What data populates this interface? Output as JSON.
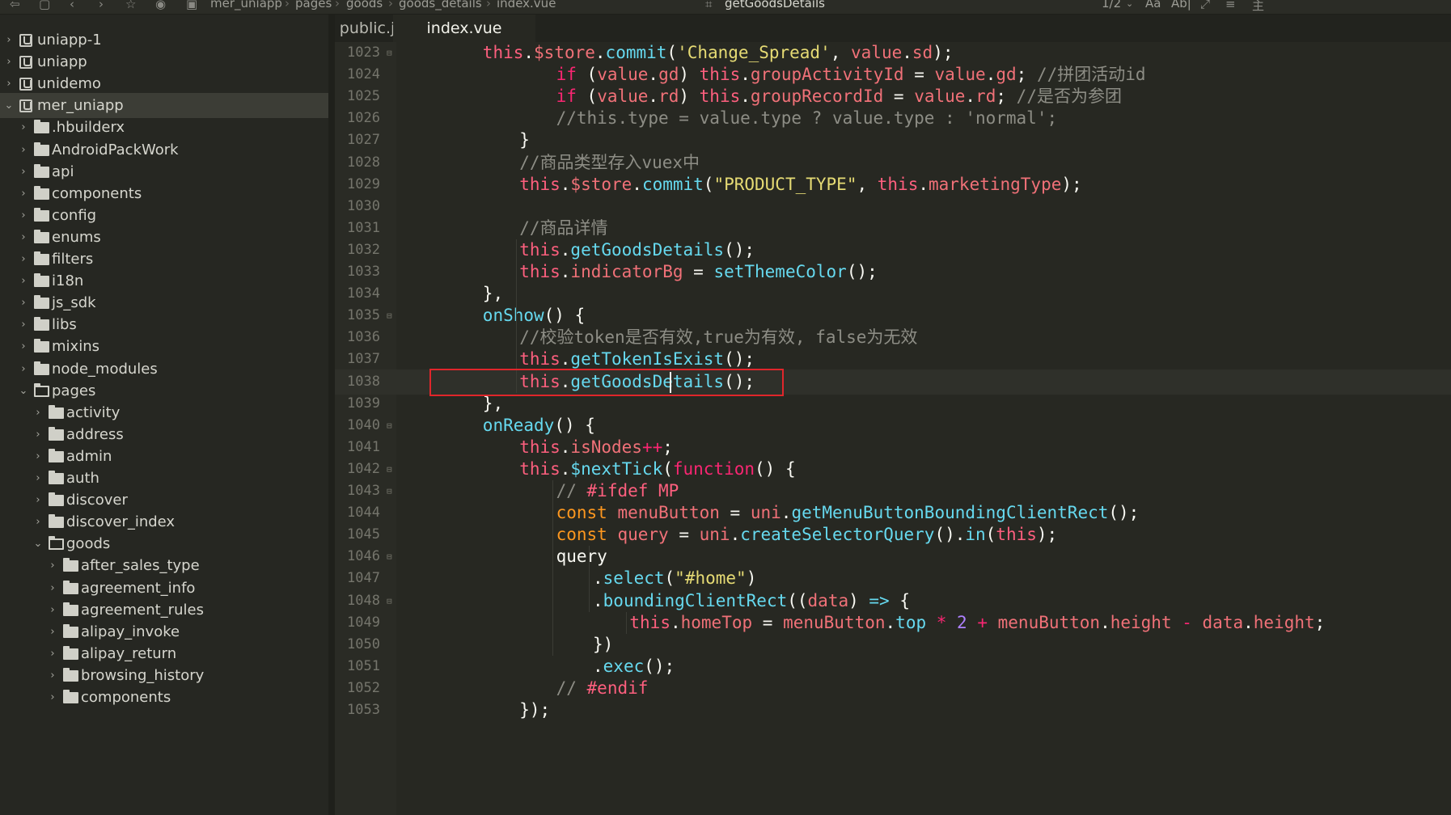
{
  "toolbar": {
    "breadcrumb": [
      "mer_uniapp",
      "pages",
      "goods",
      "goods_details",
      "index.vue"
    ],
    "function_name": "getGoodsDetails",
    "zoom_label": "1/2",
    "font_label": "Aa",
    "word_label": "Ab|",
    "icons": [
      "back-icon",
      "forward-icon",
      "star-icon",
      "run-icon",
      "pin-icon",
      "menu-icon"
    ]
  },
  "sidebar": {
    "items": [
      {
        "label": "uniapp-1",
        "kind": "project",
        "depth": 0,
        "expanded": false
      },
      {
        "label": "uniapp",
        "kind": "project",
        "depth": 0,
        "expanded": false
      },
      {
        "label": "unidemo",
        "kind": "project",
        "depth": 0,
        "expanded": false
      },
      {
        "label": "mer_uniapp",
        "kind": "project",
        "depth": 0,
        "expanded": true,
        "selected": true
      },
      {
        "label": ".hbuilderx",
        "kind": "folder",
        "depth": 1,
        "expanded": false
      },
      {
        "label": "AndroidPackWork",
        "kind": "folder",
        "depth": 1,
        "expanded": false
      },
      {
        "label": "api",
        "kind": "folder",
        "depth": 1,
        "expanded": false
      },
      {
        "label": "components",
        "kind": "folder",
        "depth": 1,
        "expanded": false
      },
      {
        "label": "config",
        "kind": "folder",
        "depth": 1,
        "expanded": false
      },
      {
        "label": "enums",
        "kind": "folder",
        "depth": 1,
        "expanded": false
      },
      {
        "label": "filters",
        "kind": "folder",
        "depth": 1,
        "expanded": false
      },
      {
        "label": "i18n",
        "kind": "folder",
        "depth": 1,
        "expanded": false
      },
      {
        "label": "js_sdk",
        "kind": "folder",
        "depth": 1,
        "expanded": false
      },
      {
        "label": "libs",
        "kind": "folder",
        "depth": 1,
        "expanded": false
      },
      {
        "label": "mixins",
        "kind": "folder",
        "depth": 1,
        "expanded": false
      },
      {
        "label": "node_modules",
        "kind": "folder",
        "depth": 1,
        "expanded": false
      },
      {
        "label": "pages",
        "kind": "folder",
        "depth": 1,
        "expanded": true
      },
      {
        "label": "activity",
        "kind": "folder",
        "depth": 2,
        "expanded": false
      },
      {
        "label": "address",
        "kind": "folder",
        "depth": 2,
        "expanded": false
      },
      {
        "label": "admin",
        "kind": "folder",
        "depth": 2,
        "expanded": false
      },
      {
        "label": "auth",
        "kind": "folder",
        "depth": 2,
        "expanded": false
      },
      {
        "label": "discover",
        "kind": "folder",
        "depth": 2,
        "expanded": false
      },
      {
        "label": "discover_index",
        "kind": "folder",
        "depth": 2,
        "expanded": false
      },
      {
        "label": "goods",
        "kind": "folder",
        "depth": 2,
        "expanded": true
      },
      {
        "label": "after_sales_type",
        "kind": "folder",
        "depth": 3,
        "expanded": false
      },
      {
        "label": "agreement_info",
        "kind": "folder",
        "depth": 3,
        "expanded": false
      },
      {
        "label": "agreement_rules",
        "kind": "folder",
        "depth": 3,
        "expanded": false
      },
      {
        "label": "alipay_invoke",
        "kind": "folder",
        "depth": 3,
        "expanded": false
      },
      {
        "label": "alipay_return",
        "kind": "folder",
        "depth": 3,
        "expanded": false
      },
      {
        "label": "browsing_history",
        "kind": "folder",
        "depth": 3,
        "expanded": false
      },
      {
        "label": "components",
        "kind": "folder",
        "depth": 3,
        "expanded": false
      }
    ]
  },
  "tabs": [
    {
      "label": "public.js",
      "active": false
    },
    {
      "label": "index.vue",
      "active": true
    }
  ],
  "editor": {
    "current_line": 1038,
    "lines": [
      {
        "n": "1023",
        "fold": true,
        "indent": 2,
        "tokens": [
          [
            "this",
            "t"
          ],
          [
            ".",
            "pl"
          ],
          [
            "$store",
            "p"
          ],
          [
            ".",
            "pl"
          ],
          [
            "commit",
            "f"
          ],
          [
            "(",
            "pl"
          ],
          [
            "'Change_Spread'",
            "s"
          ],
          [
            ", ",
            "pl"
          ],
          [
            "value",
            "p"
          ],
          [
            ".",
            "pl"
          ],
          [
            "sd",
            "p"
          ],
          [
            ");",
            "pl"
          ]
        ]
      },
      {
        "n": "1024",
        "fold": false,
        "indent": 4,
        "tokens": [
          [
            "if",
            "k"
          ],
          [
            " (",
            "pl"
          ],
          [
            "value",
            "p"
          ],
          [
            ".",
            "pl"
          ],
          [
            "gd",
            "p"
          ],
          [
            ") ",
            "pl"
          ],
          [
            "this",
            "t"
          ],
          [
            ".",
            "pl"
          ],
          [
            "groupActivityId",
            "p"
          ],
          [
            " = ",
            "pl"
          ],
          [
            "value",
            "p"
          ],
          [
            ".",
            "pl"
          ],
          [
            "gd",
            "p"
          ],
          [
            "; ",
            "pl"
          ],
          [
            "//拼团活动id",
            "c"
          ]
        ]
      },
      {
        "n": "1025",
        "fold": false,
        "indent": 4,
        "tokens": [
          [
            "if",
            "k"
          ],
          [
            " (",
            "pl"
          ],
          [
            "value",
            "p"
          ],
          [
            ".",
            "pl"
          ],
          [
            "rd",
            "p"
          ],
          [
            ") ",
            "pl"
          ],
          [
            "this",
            "t"
          ],
          [
            ".",
            "pl"
          ],
          [
            "groupRecordId",
            "p"
          ],
          [
            " = ",
            "pl"
          ],
          [
            "value",
            "p"
          ],
          [
            ".",
            "pl"
          ],
          [
            "rd",
            "p"
          ],
          [
            "; ",
            "pl"
          ],
          [
            "//是否为参团",
            "c"
          ]
        ]
      },
      {
        "n": "1026",
        "fold": false,
        "indent": 4,
        "tokens": [
          [
            "//this.type = value.type ? value.type : 'normal';",
            "c"
          ]
        ]
      },
      {
        "n": "1027",
        "fold": false,
        "indent": 3,
        "tokens": [
          [
            "}",
            "pl"
          ]
        ]
      },
      {
        "n": "1028",
        "fold": false,
        "indent": 3,
        "tokens": [
          [
            "//商品类型存入vuex中",
            "c"
          ]
        ]
      },
      {
        "n": "1029",
        "fold": false,
        "indent": 3,
        "tokens": [
          [
            "this",
            "t"
          ],
          [
            ".",
            "pl"
          ],
          [
            "$store",
            "p"
          ],
          [
            ".",
            "pl"
          ],
          [
            "commit",
            "f"
          ],
          [
            "(",
            "pl"
          ],
          [
            "\"PRODUCT_TYPE\"",
            "s"
          ],
          [
            ", ",
            "pl"
          ],
          [
            "this",
            "t"
          ],
          [
            ".",
            "pl"
          ],
          [
            "marketingType",
            "p"
          ],
          [
            ");",
            "pl"
          ]
        ]
      },
      {
        "n": "1030",
        "fold": false,
        "indent": 0,
        "tokens": []
      },
      {
        "n": "1031",
        "fold": false,
        "indent": 3,
        "tokens": [
          [
            "//商品详情",
            "c"
          ]
        ]
      },
      {
        "n": "1032",
        "fold": false,
        "indent": 3,
        "tokens": [
          [
            "this",
            "t"
          ],
          [
            ".",
            "pl"
          ],
          [
            "getGoodsDetails",
            "f"
          ],
          [
            "();",
            "pl"
          ]
        ]
      },
      {
        "n": "1033",
        "fold": false,
        "indent": 3,
        "tokens": [
          [
            "this",
            "t"
          ],
          [
            ".",
            "pl"
          ],
          [
            "indicatorBg",
            "p"
          ],
          [
            " = ",
            "pl"
          ],
          [
            "setThemeColor",
            "f"
          ],
          [
            "();",
            "pl"
          ]
        ]
      },
      {
        "n": "1034",
        "fold": false,
        "indent": 2,
        "tokens": [
          [
            "},",
            "pl"
          ]
        ]
      },
      {
        "n": "1035",
        "fold": true,
        "indent": 2,
        "tokens": [
          [
            "onShow",
            "f"
          ],
          [
            "() {",
            "pl"
          ]
        ]
      },
      {
        "n": "1036",
        "fold": false,
        "indent": 3,
        "tokens": [
          [
            "//校验token是否有效,true为有效, false为无效",
            "c"
          ]
        ]
      },
      {
        "n": "1037",
        "fold": false,
        "indent": 3,
        "tokens": [
          [
            "this",
            "t"
          ],
          [
            ".",
            "pl"
          ],
          [
            "getTokenIsExist",
            "f"
          ],
          [
            "();",
            "pl"
          ]
        ]
      },
      {
        "n": "1038",
        "fold": false,
        "indent": 3,
        "tokens": [
          [
            "this",
            "t"
          ],
          [
            ".",
            "pl"
          ],
          [
            "getGoodsDetails",
            "f"
          ],
          [
            "();",
            "pl"
          ]
        ]
      },
      {
        "n": "1039",
        "fold": false,
        "indent": 2,
        "tokens": [
          [
            "},",
            "pl"
          ]
        ]
      },
      {
        "n": "1040",
        "fold": true,
        "indent": 2,
        "tokens": [
          [
            "onReady",
            "f"
          ],
          [
            "() {",
            "pl"
          ]
        ]
      },
      {
        "n": "1041",
        "fold": false,
        "indent": 3,
        "tokens": [
          [
            "this",
            "t"
          ],
          [
            ".",
            "pl"
          ],
          [
            "isNodes",
            "p"
          ],
          [
            "++",
            "o"
          ],
          [
            ";",
            "pl"
          ]
        ]
      },
      {
        "n": "1042",
        "fold": true,
        "indent": 3,
        "tokens": [
          [
            "this",
            "t"
          ],
          [
            ".",
            "pl"
          ],
          [
            "$nextTick",
            "f"
          ],
          [
            "(",
            "pl"
          ],
          [
            "function",
            "k"
          ],
          [
            "() {",
            "pl"
          ]
        ]
      },
      {
        "n": "1043",
        "fold": true,
        "indent": 4,
        "tokens": [
          [
            "// ",
            "c"
          ],
          [
            "#ifdef MP",
            "ki"
          ]
        ]
      },
      {
        "n": "1044",
        "fold": false,
        "indent": 4,
        "tokens": [
          [
            "const",
            "d"
          ],
          [
            " ",
            "pl"
          ],
          [
            "menuButton",
            "p"
          ],
          [
            " = ",
            "pl"
          ],
          [
            "uni",
            "p"
          ],
          [
            ".",
            "pl"
          ],
          [
            "getMenuButtonBoundingClientRect",
            "f"
          ],
          [
            "();",
            "pl"
          ]
        ]
      },
      {
        "n": "1045",
        "fold": false,
        "indent": 4,
        "tokens": [
          [
            "const",
            "d"
          ],
          [
            " ",
            "pl"
          ],
          [
            "query",
            "p"
          ],
          [
            " = ",
            "pl"
          ],
          [
            "uni",
            "p"
          ],
          [
            ".",
            "pl"
          ],
          [
            "createSelectorQuery",
            "f"
          ],
          [
            "().",
            "pl"
          ],
          [
            "in",
            "f"
          ],
          [
            "(",
            "pl"
          ],
          [
            "this",
            "t"
          ],
          [
            ");",
            "pl"
          ]
        ]
      },
      {
        "n": "1046",
        "fold": true,
        "indent": 4,
        "tokens": [
          [
            "query",
            "pl"
          ]
        ]
      },
      {
        "n": "1047",
        "fold": false,
        "indent": 5,
        "tokens": [
          [
            ".",
            "pl"
          ],
          [
            "select",
            "f"
          ],
          [
            "(",
            "pl"
          ],
          [
            "\"#home\"",
            "s"
          ],
          [
            ")",
            "pl"
          ]
        ]
      },
      {
        "n": "1048",
        "fold": true,
        "indent": 5,
        "tokens": [
          [
            ".",
            "pl"
          ],
          [
            "boundingClientRect",
            "f"
          ],
          [
            "((",
            "pl"
          ],
          [
            "data",
            "p"
          ],
          [
            ") ",
            "pl"
          ],
          [
            "=>",
            "f"
          ],
          [
            " {",
            "pl"
          ]
        ]
      },
      {
        "n": "1049",
        "fold": false,
        "indent": 6,
        "tokens": [
          [
            "this",
            "t"
          ],
          [
            ".",
            "pl"
          ],
          [
            "homeTop",
            "p"
          ],
          [
            " = ",
            "pl"
          ],
          [
            "menuButton",
            "p"
          ],
          [
            ".",
            "pl"
          ],
          [
            "top",
            "f"
          ],
          [
            " * ",
            "o"
          ],
          [
            "2",
            "n"
          ],
          [
            " + ",
            "o"
          ],
          [
            "menuButton",
            "p"
          ],
          [
            ".",
            "pl"
          ],
          [
            "height",
            "p"
          ],
          [
            " - ",
            "o"
          ],
          [
            "data",
            "p"
          ],
          [
            ".",
            "pl"
          ],
          [
            "height",
            "p"
          ],
          [
            ";",
            "pl"
          ]
        ]
      },
      {
        "n": "1050",
        "fold": false,
        "indent": 5,
        "tokens": [
          [
            "})",
            "pl"
          ]
        ]
      },
      {
        "n": "1051",
        "fold": false,
        "indent": 5,
        "tokens": [
          [
            ".",
            "pl"
          ],
          [
            "exec",
            "f"
          ],
          [
            "();",
            "pl"
          ]
        ]
      },
      {
        "n": "1052",
        "fold": false,
        "indent": 4,
        "tokens": [
          [
            "// ",
            "c"
          ],
          [
            "#endif",
            "ki"
          ]
        ]
      },
      {
        "n": "1053",
        "fold": false,
        "indent": 3,
        "tokens": [
          [
            "});",
            "pl"
          ]
        ]
      }
    ]
  },
  "colors": {
    "background": "#272822",
    "sidebar": "#262722",
    "highlight_box": "#e0262b",
    "keyword": "#f92672",
    "string": "#e6db74",
    "function": "#66d9ef",
    "comment": "#8d8d85"
  }
}
